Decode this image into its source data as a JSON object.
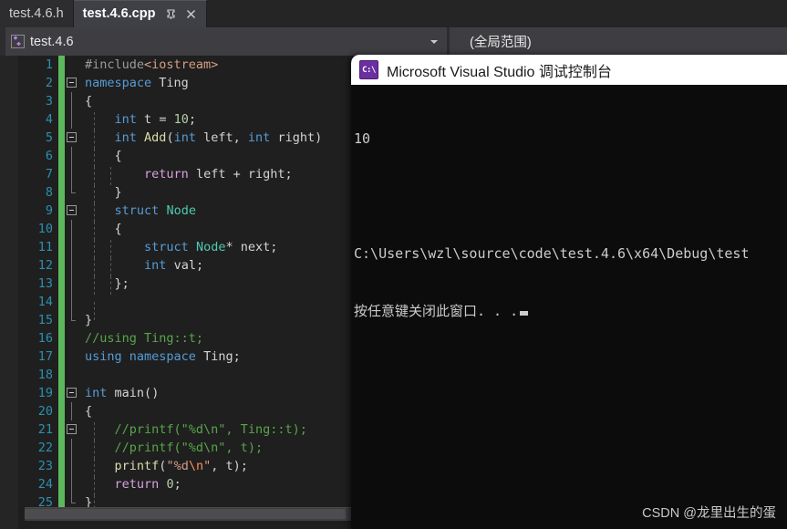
{
  "tabs": [
    {
      "label": "test.4.6.h",
      "active": false
    },
    {
      "label": "test.4.6.cpp",
      "active": true,
      "pin_icon": "pin-icon",
      "close_icon": "close-icon"
    }
  ],
  "navbar": {
    "project_icon": "cpp-project-icon",
    "project": "test.4.6",
    "scope": "(全局范围)",
    "dropdown_icon": "chevron-down-icon"
  },
  "editor": {
    "lines": [
      {
        "n": "1",
        "text": "#include<iostream>"
      },
      {
        "n": "2",
        "text": "namespace Ting"
      },
      {
        "n": "3",
        "text": "{"
      },
      {
        "n": "4",
        "text": "    int t = 10;"
      },
      {
        "n": "5",
        "text": "    int Add(int left, int right)"
      },
      {
        "n": "6",
        "text": "    {"
      },
      {
        "n": "7",
        "text": "        return left + right;"
      },
      {
        "n": "8",
        "text": "    }"
      },
      {
        "n": "9",
        "text": "    struct Node"
      },
      {
        "n": "10",
        "text": "    {"
      },
      {
        "n": "11",
        "text": "        struct Node* next;"
      },
      {
        "n": "12",
        "text": "        int val;"
      },
      {
        "n": "13",
        "text": "    };"
      },
      {
        "n": "14",
        "text": ""
      },
      {
        "n": "15",
        "text": "}"
      },
      {
        "n": "16",
        "text": "//using Ting::t;"
      },
      {
        "n": "17",
        "text": "using namespace Ting;"
      },
      {
        "n": "18",
        "text": ""
      },
      {
        "n": "19",
        "text": "int main()"
      },
      {
        "n": "20",
        "text": "{"
      },
      {
        "n": "21",
        "text": "    //printf(\"%d\\n\", Ting::t);"
      },
      {
        "n": "22",
        "text": "    //printf(\"%d\\n\", t);"
      },
      {
        "n": "23",
        "text": "    printf(\"%d\\n\", t);"
      },
      {
        "n": "24",
        "text": "    return 0;"
      },
      {
        "n": "25",
        "text": "}"
      }
    ],
    "colors": {
      "background": "#1f1f1f",
      "line_number": "#2b91af",
      "change_bar": "#5cb85c",
      "keyword": "#569cd6",
      "control": "#d8a0df",
      "type": "#4ec9b0",
      "function": "#dcdcaa",
      "string": "#d69d85",
      "comment": "#57a64a",
      "number": "#b5cea8",
      "preprocessor": "#9b9b9b"
    }
  },
  "console": {
    "icon": "cmd-icon",
    "icon_glyph": "C:\\",
    "title": "Microsoft Visual Studio 调试控制台",
    "output_value": "10",
    "output_path": "C:\\Users\\wzl\\source\\code\\test.4.6\\x64\\Debug\\test",
    "output_prompt": "按任意键关闭此窗口. . ."
  },
  "watermark": "CSDN @龙里出生的蛋"
}
